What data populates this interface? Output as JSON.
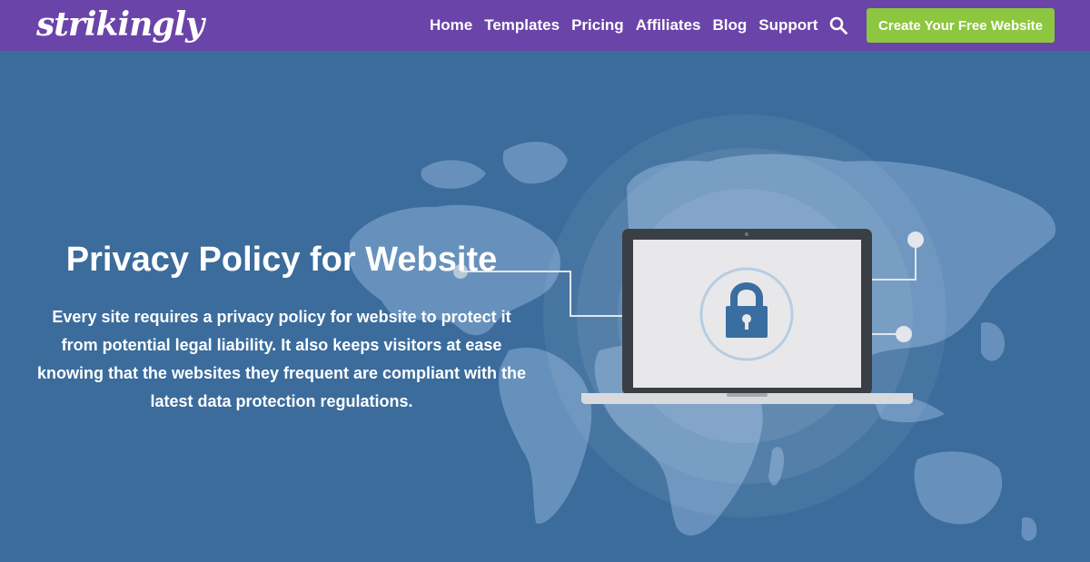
{
  "brand": {
    "logo_text": "strikingly"
  },
  "nav": {
    "items": [
      {
        "label": "Home"
      },
      {
        "label": "Templates"
      },
      {
        "label": "Pricing"
      },
      {
        "label": "Affiliates"
      },
      {
        "label": "Blog"
      },
      {
        "label": "Support"
      }
    ],
    "search_icon": "search-icon",
    "cta_label": "Create Your Free Website"
  },
  "hero": {
    "title": "Privacy Policy for Website",
    "description": "Every site requires a privacy policy for website to protect it from potential legal liability. It also keeps visitors at ease knowing that the websites they frequent are compliant with the latest data protection regulations.",
    "illustration_icons": [
      "world-map",
      "laptop-icon",
      "padlock-icon"
    ]
  },
  "colors": {
    "nav_bg": "#6a44a8",
    "hero_bg": "#3b6c9c",
    "cta_bg": "#8dc63f",
    "map_fill": "#6f98c2",
    "screen": "#e8e8ea",
    "lock": "#3a6ea0"
  }
}
